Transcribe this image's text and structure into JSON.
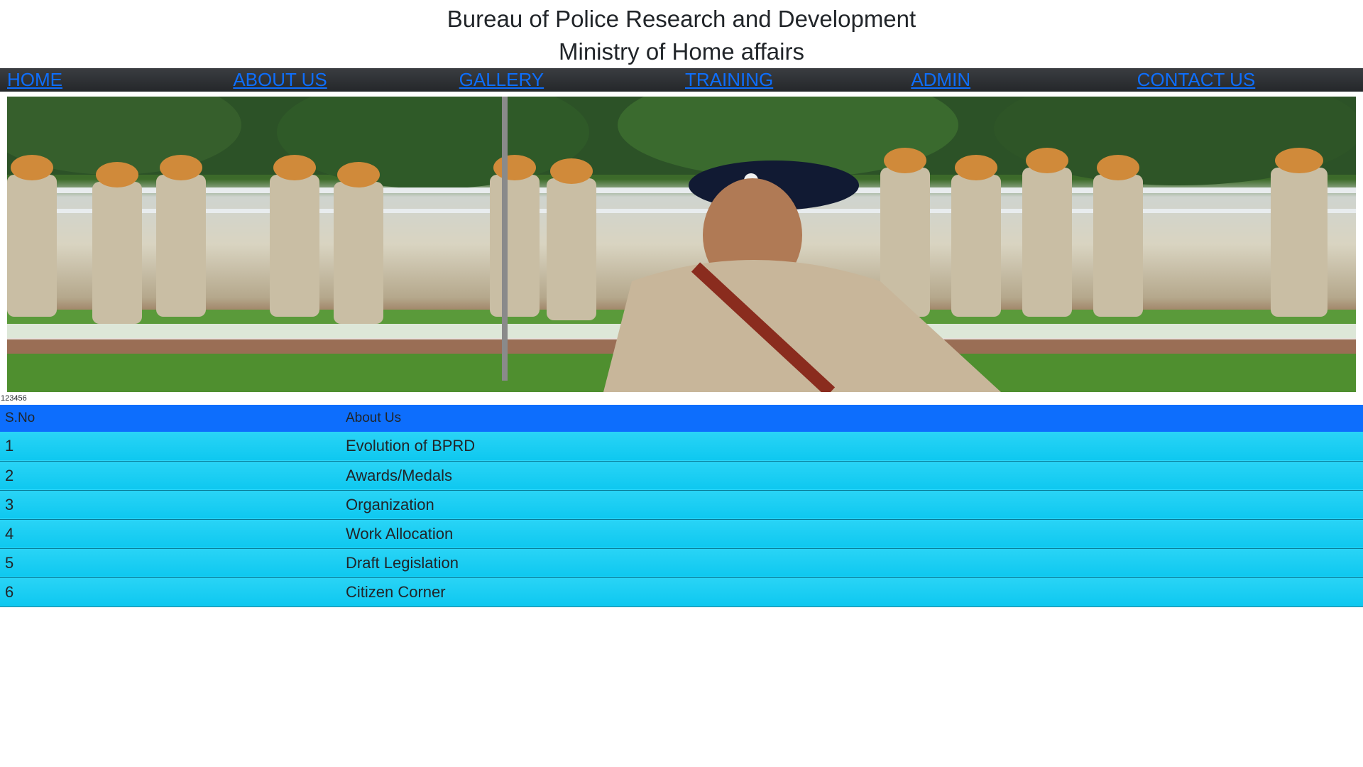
{
  "header": {
    "title_line1": "Bureau of Police Research and Development",
    "title_line2": "Ministry of Home affairs"
  },
  "nav": {
    "items": [
      {
        "label": "HOME"
      },
      {
        "label": "ABOUT US"
      },
      {
        "label": "GALLERY"
      },
      {
        "label": "TRAINING"
      },
      {
        "label": "ADMIN"
      },
      {
        "label": "CONTACT US"
      }
    ]
  },
  "banner": {
    "caption": "123456"
  },
  "table": {
    "headers": [
      "S.No",
      "About Us"
    ],
    "rows": [
      {
        "sno": "1",
        "label": "Evolution of BPRD"
      },
      {
        "sno": "2",
        "label": "Awards/Medals"
      },
      {
        "sno": "3",
        "label": "Organization"
      },
      {
        "sno": "4",
        "label": "Work Allocation"
      },
      {
        "sno": "5",
        "label": "Draft Legislation"
      },
      {
        "sno": "6",
        "label": "Citizen Corner"
      }
    ]
  },
  "colors": {
    "nav_link": "#0d6efd",
    "table_header_bg": "#0d6efd",
    "table_row_bg": "#17cbf2",
    "nav_bg": "#2b2e31"
  }
}
